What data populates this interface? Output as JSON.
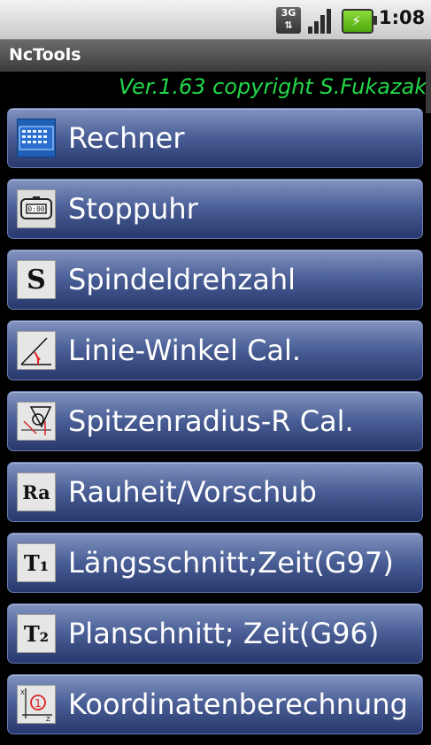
{
  "status_bar": {
    "network": "3G",
    "time": "1:08",
    "icons": [
      "signal-icon",
      "battery-charging-icon"
    ]
  },
  "app": {
    "title": "NcTools",
    "version_text": "Ver.1.63 copyright S.Fukazak"
  },
  "menu": {
    "items": [
      {
        "label": "Rechner",
        "icon": "calculator-icon"
      },
      {
        "label": "Stoppuhr",
        "icon": "stopwatch-icon"
      },
      {
        "label": "Spindeldrehzahl",
        "icon": "spindle-s-icon",
        "icon_text": "S"
      },
      {
        "label": "Linie-Winkel Cal.",
        "icon": "angle-icon"
      },
      {
        "label": "Spitzenradius-R Cal.",
        "icon": "tip-radius-icon"
      },
      {
        "label": "Rauheit/Vorschub",
        "icon": "roughness-icon",
        "icon_text": "Ra"
      },
      {
        "label": "Längsschnitt;Zeit(G97)",
        "icon": "longitudinal-time-icon",
        "icon_text": "T₁"
      },
      {
        "label": "Planschnitt; Zeit(G96)",
        "icon": "facing-time-icon",
        "icon_text": "T₂"
      },
      {
        "label": "Koordinatenberechnung",
        "icon": "coordinates-icon"
      }
    ]
  },
  "colors": {
    "accent_text": "#22d84a",
    "button_top": "#8193c0",
    "button_bottom": "#27386d"
  }
}
